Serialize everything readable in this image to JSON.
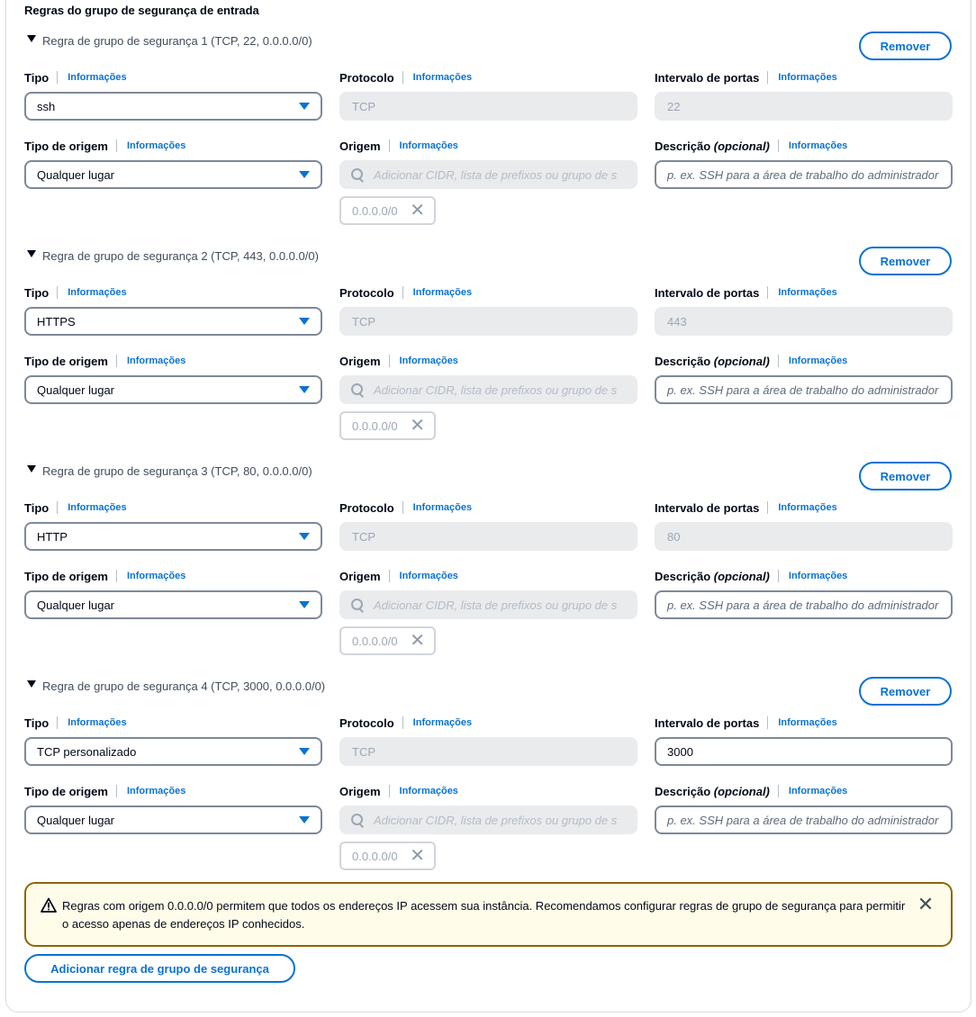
{
  "section": {
    "title": "Regras do grupo de segurança de entrada"
  },
  "common": {
    "remove_label": "Remover",
    "info_label": "Informações",
    "type_label": "Tipo",
    "protocol_label": "Protocolo",
    "port_range_label": "Intervalo de portas",
    "source_type_label": "Tipo de origem",
    "source_label": "Origem",
    "description_label": "Descrição",
    "description_optional": "(opcional)",
    "source_placeholder": "Adicionar CIDR, lista de prefixos ou grupo de s",
    "description_placeholder": "p. ex. SSH para a área de trabalho do administrador"
  },
  "rules": [
    {
      "title": "Regra de grupo de segurança 1 (TCP, 22, 0.0.0.0/0)",
      "type": "ssh",
      "protocol": "TCP",
      "port": "22",
      "port_editable": false,
      "source_type": "Qualquer lugar",
      "token": "0.0.0.0/0"
    },
    {
      "title": "Regra de grupo de segurança 2 (TCP, 443, 0.0.0.0/0)",
      "type": "HTTPS",
      "protocol": "TCP",
      "port": "443",
      "port_editable": false,
      "source_type": "Qualquer lugar",
      "token": "0.0.0.0/0"
    },
    {
      "title": "Regra de grupo de segurança 3 (TCP, 80, 0.0.0.0/0)",
      "type": "HTTP",
      "protocol": "TCP",
      "port": "80",
      "port_editable": false,
      "source_type": "Qualquer lugar",
      "token": "0.0.0.0/0"
    },
    {
      "title": "Regra de grupo de segurança 4 (TCP, 3000, 0.0.0.0/0)",
      "type": "TCP personalizado",
      "protocol": "TCP",
      "port": "3000",
      "port_editable": true,
      "source_type": "Qualquer lugar",
      "token": "0.0.0.0/0"
    }
  ],
  "alert": {
    "text": "Regras com origem 0.0.0.0/0 permitem que todos os endereços IP acessem sua instância. Recomendamos configurar regras de grupo de segurança para permitir o acesso apenas de endereços IP conhecidos.",
    "icon": "warning-icon",
    "color": "#8d6605"
  },
  "add_rule_label": "Adicionar regra de grupo de segurança",
  "colors": {
    "accent": "#0972d3",
    "warning_border": "#8d6605",
    "warning_bg": "#fffce9"
  }
}
